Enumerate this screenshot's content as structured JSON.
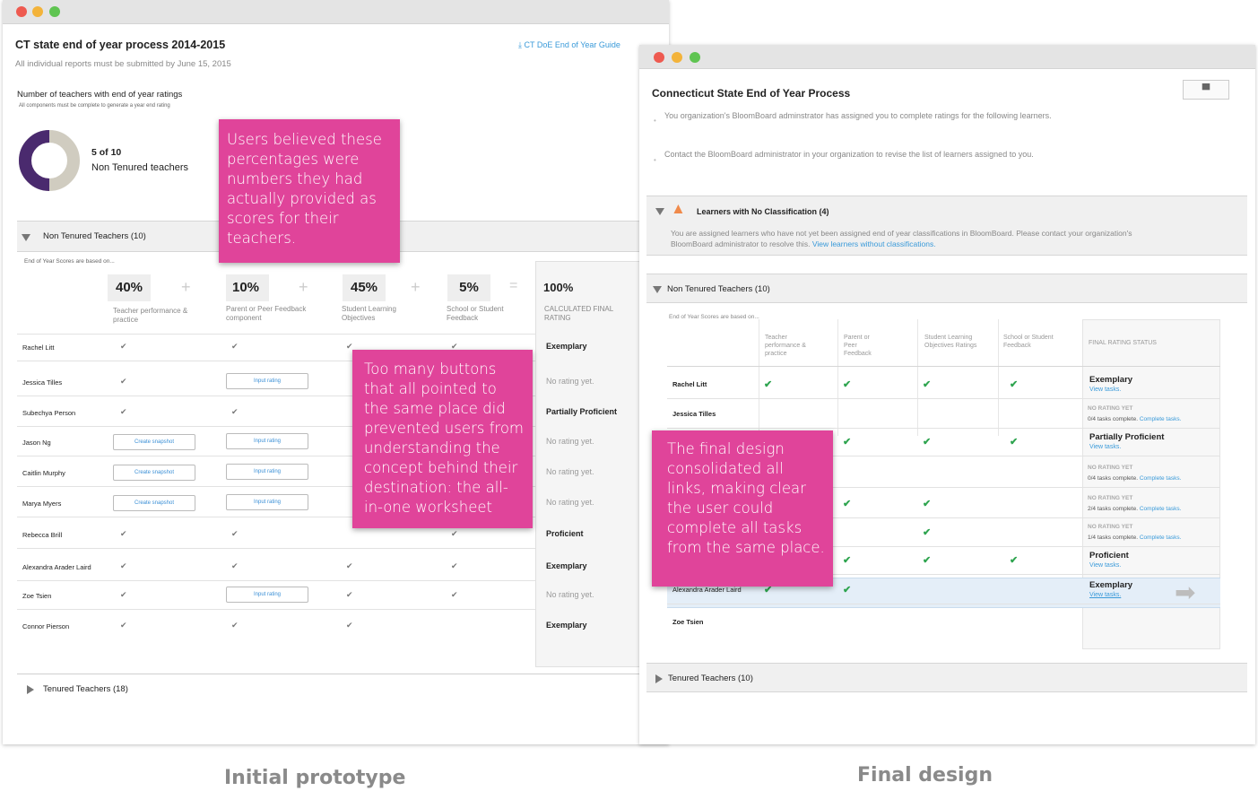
{
  "left": {
    "title": "CT state end of year process 2014-2015",
    "subtitle": "All individual reports must be submitted by June 15, 2015",
    "guide_link": "CT DoE End of Year Guide",
    "count_heading": "Number of teachers with end of year ratings",
    "count_note": "All components must be complete to generate a year end rating",
    "count_value": "5 of 10",
    "count_label": "Non Tenured teachers",
    "donut_fraction": 0.5,
    "section_nontenured": "Non Tenured Teachers (10)",
    "section_tenured": "Tenured Teachers (18)",
    "scores_note": "End of Year Scores are based on...",
    "components": [
      {
        "pct": "40%",
        "label": "Teacher performance & practice"
      },
      {
        "pct": "10%",
        "label": "Parent or Peer Feedback component"
      },
      {
        "pct": "45%",
        "label": "Student Learning Objectives"
      },
      {
        "pct": "5%",
        "label": "School or Student Feedback"
      }
    ],
    "total_pct": "100%",
    "total_label": "CALCULATED FINAL RATING",
    "btn_snapshot": "Create snapshot",
    "btn_input": "Input rating",
    "rows": [
      {
        "name": "Rachel Litt",
        "rating": "Exemplary"
      },
      {
        "name": "Jessica Tilles",
        "rating": "No rating yet."
      },
      {
        "name": "Subechya Person",
        "rating": "Partially Proficient"
      },
      {
        "name": "Jason Ng",
        "rating": "No rating yet."
      },
      {
        "name": "Caitlin Murphy",
        "rating": "No rating yet."
      },
      {
        "name": "Marya Myers",
        "rating": "No rating yet."
      },
      {
        "name": "Rebecca Brill",
        "rating": "Proficient"
      },
      {
        "name": "Alexandra Arader Laird",
        "rating": "Exemplary"
      },
      {
        "name": "Zoe Tsien",
        "rating": "No rating yet."
      },
      {
        "name": "Connor Pierson",
        "rating": "Exemplary"
      }
    ],
    "callout1": "Users believed these percentages were numbers they had actually provided as scores for their teachers.",
    "callout2": "Too many buttons that all pointed to the same place did prevented users from understanding the concept behind their destination: the all-in-one worksheet",
    "caption": "Initial prototype"
  },
  "right": {
    "title": "Connecticut State End of Year Process",
    "bullet1": "You organization's BloomBoard adminstrator has assigned you to complete ratings for the following learners.",
    "bullet2": "Contact the BloomBoard administrator in your organization to revise the list of learners assigned to you.",
    "warn_title": "Learners with No Classification (4)",
    "warn_text": "You are assigned learners who have not yet been assigned end of year classifications in BloomBoard. Please contact your organization's BloomBoard administrator to resolve this.",
    "warn_link": "View learners without classifications.",
    "section_nontenured": "Non Tenured Teachers (10)",
    "section_tenured": "Tenured Teachers (10)",
    "scores_note": "End of Year Scores are based on...",
    "columns": [
      "Teacher performance & practice",
      "Parent or Peer Feedback",
      "Student Learning Objectives Ratings",
      "School or Student Feedback",
      "FINAL RATING STATUS"
    ],
    "view_tasks": "View tasks.",
    "no_rating": "NO RATING YET",
    "complete_tasks": "Complete tasks.",
    "rows": [
      {
        "name": "Rachel Litt",
        "status": "Exemplary",
        "tasks": ""
      },
      {
        "name": "Jessica Tilles",
        "status": "",
        "tasks": "0/4 tasks complete."
      },
      {
        "name": "",
        "status": "Partially Proficient",
        "tasks": ""
      },
      {
        "name": "",
        "status": "",
        "tasks": "0/4 tasks complete."
      },
      {
        "name": "",
        "status": "",
        "tasks": "2/4 tasks complete."
      },
      {
        "name": "",
        "status": "",
        "tasks": "1/4 tasks complete."
      },
      {
        "name": "",
        "status": "Proficient",
        "tasks": ""
      },
      {
        "name": "Alexandra Arader Laird",
        "status": "Exemplary",
        "tasks": ""
      },
      {
        "name": "Zoe Tsien",
        "status": "",
        "tasks": ""
      }
    ],
    "callout": "The final design consolidated all links, making clear the user could complete all tasks from the same place.",
    "caption": "Final design"
  }
}
